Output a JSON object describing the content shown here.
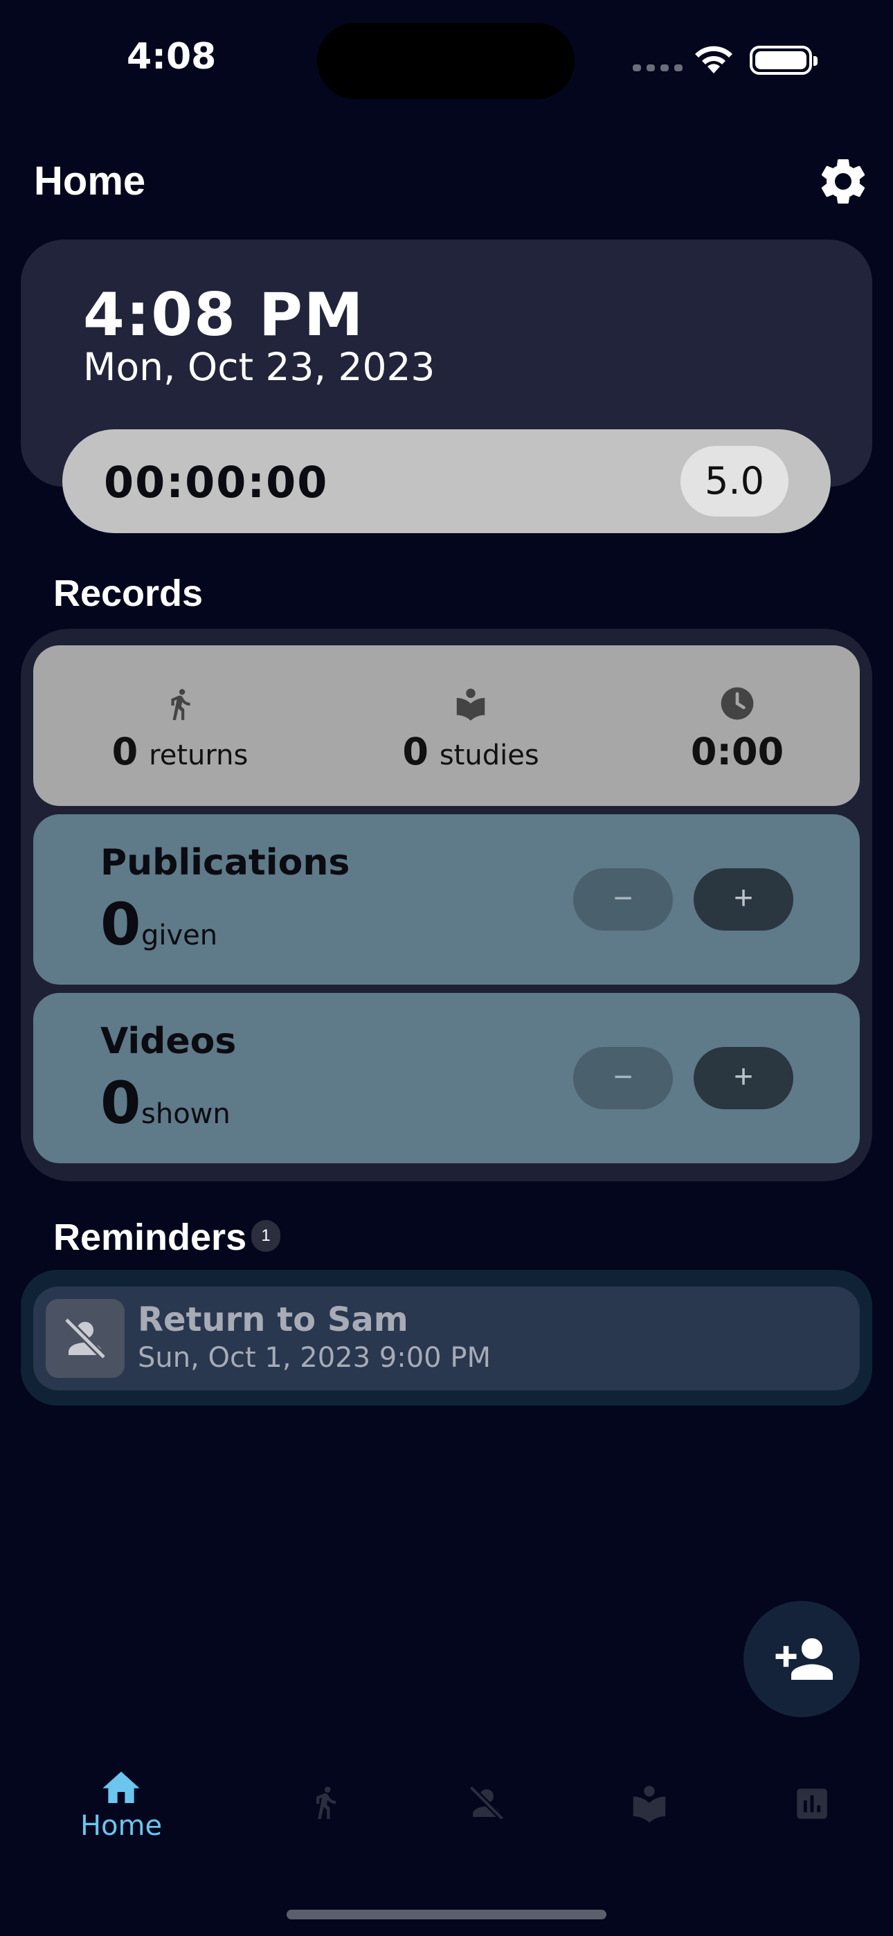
{
  "status_bar": {
    "time": "4:08"
  },
  "header": {
    "title": "Home"
  },
  "clock": {
    "time": "4:08 PM",
    "date": "Mon, Oct 23, 2023"
  },
  "timer": {
    "value": "00:00:00",
    "rate": "5.0"
  },
  "records": {
    "title": "Records",
    "stats": [
      {
        "icon": "walking-person-icon",
        "value": "0",
        "unit": "returns"
      },
      {
        "icon": "open-book-icon",
        "value": "0",
        "unit": "studies"
      },
      {
        "icon": "clock-icon",
        "value": "0:00",
        "unit": ""
      }
    ],
    "publications": {
      "title": "Publications",
      "value": "0",
      "unit": "given",
      "minus_label": "−",
      "plus_label": "+"
    },
    "videos": {
      "title": "Videos",
      "value": "0",
      "unit": "shown",
      "minus_label": "−",
      "plus_label": "+"
    }
  },
  "reminders": {
    "title": "Reminders",
    "count": "1",
    "items": [
      {
        "icon": "person-off-icon",
        "title": "Return to Sam",
        "subtitle": "Sun, Oct 1, 2023 9:00 PM"
      }
    ]
  },
  "fab": {
    "icon": "add-person-icon"
  },
  "tabbar": {
    "items": [
      {
        "label": "Home",
        "icon": "home-icon",
        "active": true
      },
      {
        "label": "",
        "icon": "walking-person-icon",
        "active": false
      },
      {
        "label": "",
        "icon": "person-off-icon",
        "active": false
      },
      {
        "label": "",
        "icon": "open-book-icon",
        "active": false
      },
      {
        "label": "",
        "icon": "bar-chart-icon",
        "active": false
      }
    ]
  },
  "colors": {
    "background": "#03061d",
    "card": "#21243a",
    "accent": "#6bc5ef",
    "counter_card": "#5f7a88"
  }
}
